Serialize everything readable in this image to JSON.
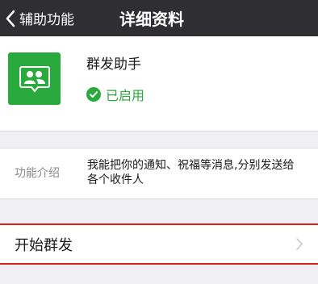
{
  "navbar": {
    "back_label": "辅助功能",
    "title": "详细资料",
    "back_icon": "chevron-left-icon"
  },
  "profile": {
    "app_name": "群发助手",
    "status": "已启用",
    "app_icon": "group-people-icon",
    "status_icon": "check-circle-icon"
  },
  "intro": {
    "label": "功能介绍",
    "text": "我能把你的通知、祝福等消息,分别发送给各个收件人"
  },
  "action": {
    "label": "开始群发",
    "icon": "chevron-right-icon"
  },
  "colors": {
    "navbar_bg": "#2e2e33",
    "accent_green": "#2aa93c",
    "highlight_red": "#d61f1f",
    "page_bg": "#efeff4"
  }
}
